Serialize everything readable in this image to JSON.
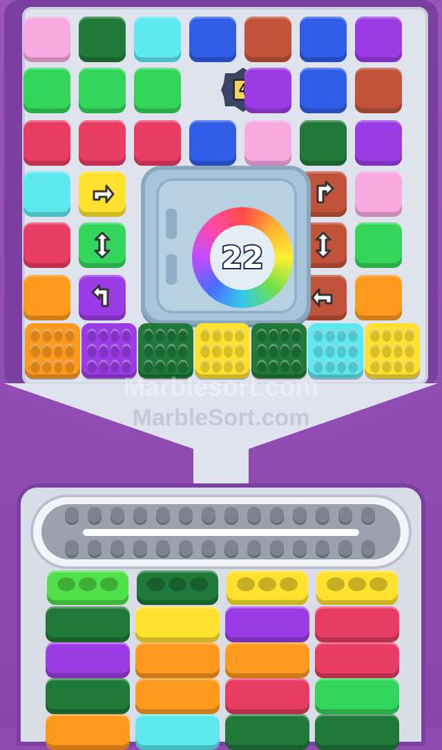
{
  "game": {
    "watermark_primary": "Marblesort.com",
    "watermark_secondary": "MarbleSort.com",
    "lock_counter": "4",
    "vault_counter": "22"
  },
  "colors": {
    "pink": "#f7a9e0",
    "dgreen": "#1f7a3a",
    "cyan": "#5ee8f0",
    "blue": "#2f5de8",
    "brown": "#c0533a",
    "purple": "#9b3be6",
    "green": "#33d65a",
    "red": "#e83c62",
    "orange": "#ff9a1f",
    "yellow": "#ffe12e",
    "lime": "#4fe04a"
  },
  "grid_rows": [
    [
      "pink",
      "dgreen",
      "cyan",
      "blue",
      "brown",
      "blue",
      "purple"
    ],
    [
      "green",
      "green",
      "green",
      "counter",
      "purple",
      "blue",
      "brown"
    ],
    [
      "red",
      "red",
      "red",
      "blue",
      "pink",
      "dgreen",
      "purple"
    ],
    [
      "cyan",
      "arrow-yellow",
      "vault",
      "vault",
      "vault",
      "arrow-brown",
      "pink"
    ],
    [
      "red",
      "arrow-green",
      "vault",
      "vault",
      "vault",
      "arrow-brown",
      "green"
    ],
    [
      "orange",
      "arrow-purple",
      "vault",
      "vault",
      "vault",
      "arrow-brown",
      "orange"
    ]
  ],
  "popit_row": [
    "orange",
    "purple",
    "dgreen",
    "yellow",
    "dgreen",
    "cyan",
    "yellow"
  ],
  "trays": [
    [
      "lime",
      "dgreen",
      "purple",
      "dgreen",
      "orange"
    ],
    [
      "dgreen",
      "yellow",
      "orange",
      "orange",
      "cyan"
    ],
    [
      "yellow",
      "purple",
      "orange",
      "red",
      "dgreen"
    ],
    [
      "yellow",
      "red",
      "red",
      "green",
      "dgreen"
    ]
  ]
}
